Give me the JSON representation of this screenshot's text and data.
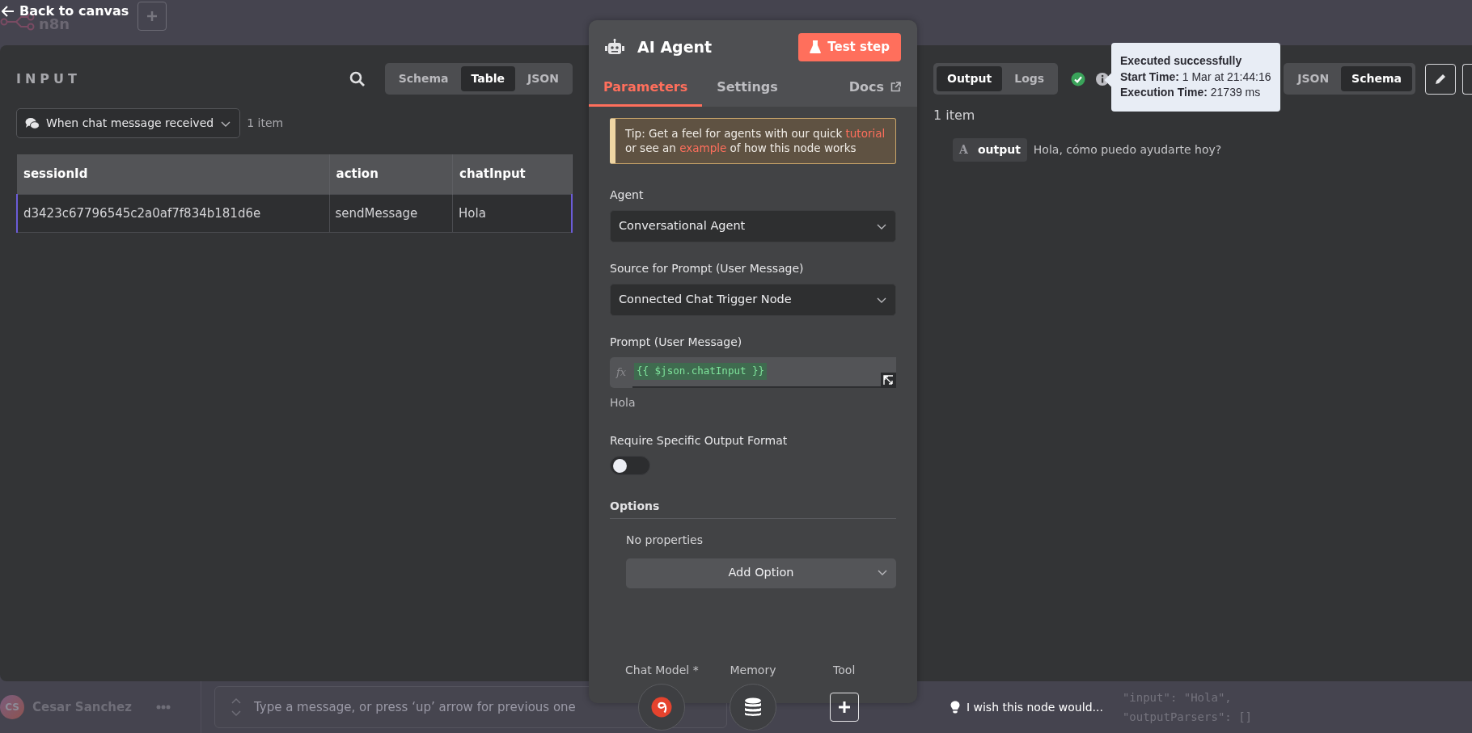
{
  "top_bar": {
    "back_link": "Back to canvas",
    "logo": "n8n"
  },
  "input_panel": {
    "title": "INPUT",
    "view_tabs": [
      {
        "label": "Schema",
        "selected": false
      },
      {
        "label": "Table",
        "selected": true
      },
      {
        "label": "JSON",
        "selected": false
      }
    ],
    "node_select": "When chat message received",
    "item_count": "1 item",
    "table": {
      "columns": [
        "sessionId",
        "action",
        "chatInput"
      ],
      "rows": [
        [
          "d3423c67796545c2a0af7f834b181d6e",
          "sendMessage",
          "Hola"
        ]
      ]
    }
  },
  "node_panel": {
    "title": "AI Agent",
    "test_button": "Test step",
    "tabs": [
      {
        "label": "Parameters",
        "selected": true
      },
      {
        "label": "Settings",
        "selected": false
      }
    ],
    "docs_link": "Docs",
    "tip": [
      {
        "kind": "text",
        "text": "Tip: Get a feel for agents with our quick "
      },
      {
        "kind": "link",
        "text": "tutorial"
      },
      {
        "kind": "text",
        "text": " or see an "
      },
      {
        "kind": "link",
        "text": "example"
      },
      {
        "kind": "text",
        "text": " of how this node works"
      }
    ],
    "fields": [
      {
        "kind": "select",
        "label": "Agent",
        "value": "Conversational Agent"
      },
      {
        "kind": "select",
        "label": "Source for Prompt (User Message)",
        "value": "Connected Chat Trigger Node"
      },
      {
        "kind": "expression",
        "label": "Prompt (User Message)",
        "prefix": "fx",
        "value": "{{ $json.chatInput }}",
        "preview": "Hola"
      },
      {
        "kind": "toggle",
        "label": "Require Specific Output Format",
        "on": false
      }
    ],
    "options": {
      "title": "Options",
      "empty_text": "No properties",
      "add_button": "Add Option"
    },
    "connectors": [
      {
        "label": "Chat Model *",
        "kind": "model"
      },
      {
        "label": "Memory",
        "kind": "memory"
      },
      {
        "label": "Tool",
        "kind": "add"
      }
    ]
  },
  "output_panel": {
    "mode_tabs": [
      {
        "label": "Output",
        "selected": true
      },
      {
        "label": "Logs",
        "selected": false
      }
    ],
    "succeeded": true,
    "tooltip": {
      "title": "Executed successfully",
      "lines": [
        {
          "key": "Start Time:",
          "value": "1 Mar at 21:44:16"
        },
        {
          "key": "Execution Time:",
          "value": "21739 ms"
        }
      ]
    },
    "view_tabs": [
      {
        "label": "JSON",
        "selected": false
      },
      {
        "label": "Schema",
        "selected": true
      }
    ],
    "item_count": "1 item",
    "fields": [
      {
        "type": "A",
        "name": "output",
        "value": "Hola, cómo puedo ayudarte hoy?"
      }
    ]
  },
  "bottom": {
    "user": {
      "initials": "CS",
      "name": "Cesar Sanchez"
    },
    "message_placeholder": "Type a message, or press ‘up’ arrow for previous one",
    "feedback": "I wish this node would...",
    "json_lines": [
      "\"input\": \"Hola\",",
      "\"outputParsers\": []"
    ]
  }
}
